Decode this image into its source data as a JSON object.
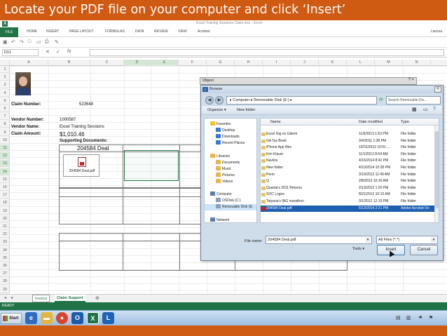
{
  "caption": "Locate your PDF file on your computer and click ‘Insert’",
  "excel": {
    "window_title": "Excel Training Sessions Claim.xlsx - Excel",
    "user": "Larissa",
    "tabs": [
      "FILE",
      "HOME",
      "INSERT",
      "PAGE LAYOUT",
      "FORMULAS",
      "DATA",
      "REVIEW",
      "VIEW",
      "Acrobat"
    ],
    "name_box": "D11",
    "fx": "fx",
    "columns": [
      "A",
      "B",
      "C",
      "D",
      "E",
      "F",
      "G",
      "H",
      "I",
      "J",
      "K",
      "L",
      "M",
      "N"
    ],
    "rows": [
      "1",
      "2",
      "3",
      "4",
      "5",
      "6",
      "7",
      "8",
      "9",
      "10",
      "11",
      "12",
      "13",
      "14",
      "15",
      "16",
      "17",
      "18",
      "19",
      "20",
      "21",
      "22",
      "23",
      "24",
      "25",
      "26",
      "27",
      "28",
      "29"
    ],
    "labels": {
      "claim_number_label": "Claim Number:",
      "claim_number_value": "523648",
      "vendor_number_label": "Vendor Number:",
      "vendor_number_value": "1000587",
      "vendor_name_label": "Vendor Name:",
      "vendor_name_value": "Excel Training Sessions",
      "claim_amount_label": "Claim Amount:",
      "claim_amount_value": "$1,010.46",
      "supporting_label": "Supporting Documents:",
      "deal_header": "204584 Deal",
      "pdf_object_label": "204584 Deal.pdf"
    },
    "sheet_tabs": [
      "Invoice",
      "Claim Support"
    ],
    "status": "READY"
  },
  "dialog_outer": {
    "title": "Object",
    "buttons": "? ×"
  },
  "browse": {
    "title": "Browse",
    "address": "▸ Computer ▸ Removable Disk (E:) ▸",
    "search_placeholder": "Search Removable Dis...",
    "toolbar": [
      "Organize ▾",
      "New folder"
    ],
    "nav": [
      {
        "label": "Favorites",
        "color": "#f2c230"
      },
      {
        "label": "Desktop",
        "color": "#3a7bd5"
      },
      {
        "label": "Downloads",
        "color": "#3a7bd5"
      },
      {
        "label": "Recent Places",
        "color": "#3a7bd5"
      },
      {
        "label": "",
        "color": ""
      },
      {
        "label": "Libraries",
        "color": "#e6b84a"
      },
      {
        "label": "Documents",
        "color": "#e6b84a"
      },
      {
        "label": "Music",
        "color": "#e6b84a"
      },
      {
        "label": "Pictures",
        "color": "#e6b84a"
      },
      {
        "label": "Videos",
        "color": "#e6b84a"
      },
      {
        "label": "",
        "color": ""
      },
      {
        "label": "Computer",
        "color": "#5a7fa8"
      },
      {
        "label": "OSDisk (C:)",
        "color": "#8aa0b8"
      },
      {
        "label": "Removable Disk (E:",
        "color": "#8aa0b8"
      },
      {
        "label": "",
        "color": ""
      },
      {
        "label": "Network",
        "color": "#5a7fa8"
      }
    ],
    "headers": {
      "name": "Name",
      "date": "Date modified",
      "type": "Type"
    },
    "files": [
      {
        "name": "Excel Gig on Udemi",
        "date": "11/6/2013 1:53 PM",
        "type": "File folder"
      },
      {
        "name": "GA Tax Book",
        "date": "3/4/2011 1:38 PM",
        "type": "File folder"
      },
      {
        "name": "iPhone App files",
        "date": "10/31/2012 10:51 ...",
        "type": "File folder"
      },
      {
        "name": "Kim Klaver",
        "date": "11/1/2012 8:54 AM",
        "type": "File folder"
      },
      {
        "name": "Navlins",
        "date": "4/16/2014 8:42 PM",
        "type": "File folder"
      },
      {
        "name": "New folder",
        "date": "4/10/2014 10:28 PM",
        "type": "File folder"
      },
      {
        "name": "Perm",
        "date": "3/19/2012 11:49 AM",
        "type": "File folder"
      },
      {
        "name": "Q",
        "date": "2/8/2013 10:16 AM",
        "type": "File folder"
      },
      {
        "name": "Quanta's 2011 Returns",
        "date": "2/13/2012 1:20 PM",
        "type": "File folder"
      },
      {
        "name": "SOC Logos",
        "date": "8/21/2012 10:13 AM",
        "type": "File folder"
      },
      {
        "name": "Tatyana's ING marathon",
        "date": "3/1/2012 12:19 PM",
        "type": "File folder"
      },
      {
        "name": "204584 Deal.pdf",
        "date": "6/13/2014 2:21 PM",
        "type": "Adobe Acrobat Do",
        "pdf": true,
        "selected": true
      }
    ],
    "filename_label": "File name:",
    "filename_value": "204584 Deal.pdf",
    "filetype_value": "All Files (*.*)",
    "tools_label": "Tools ▾",
    "insert_label": "Insert",
    "cancel_label": "Cancel"
  },
  "taskbar": {
    "start_label": "Start"
  }
}
